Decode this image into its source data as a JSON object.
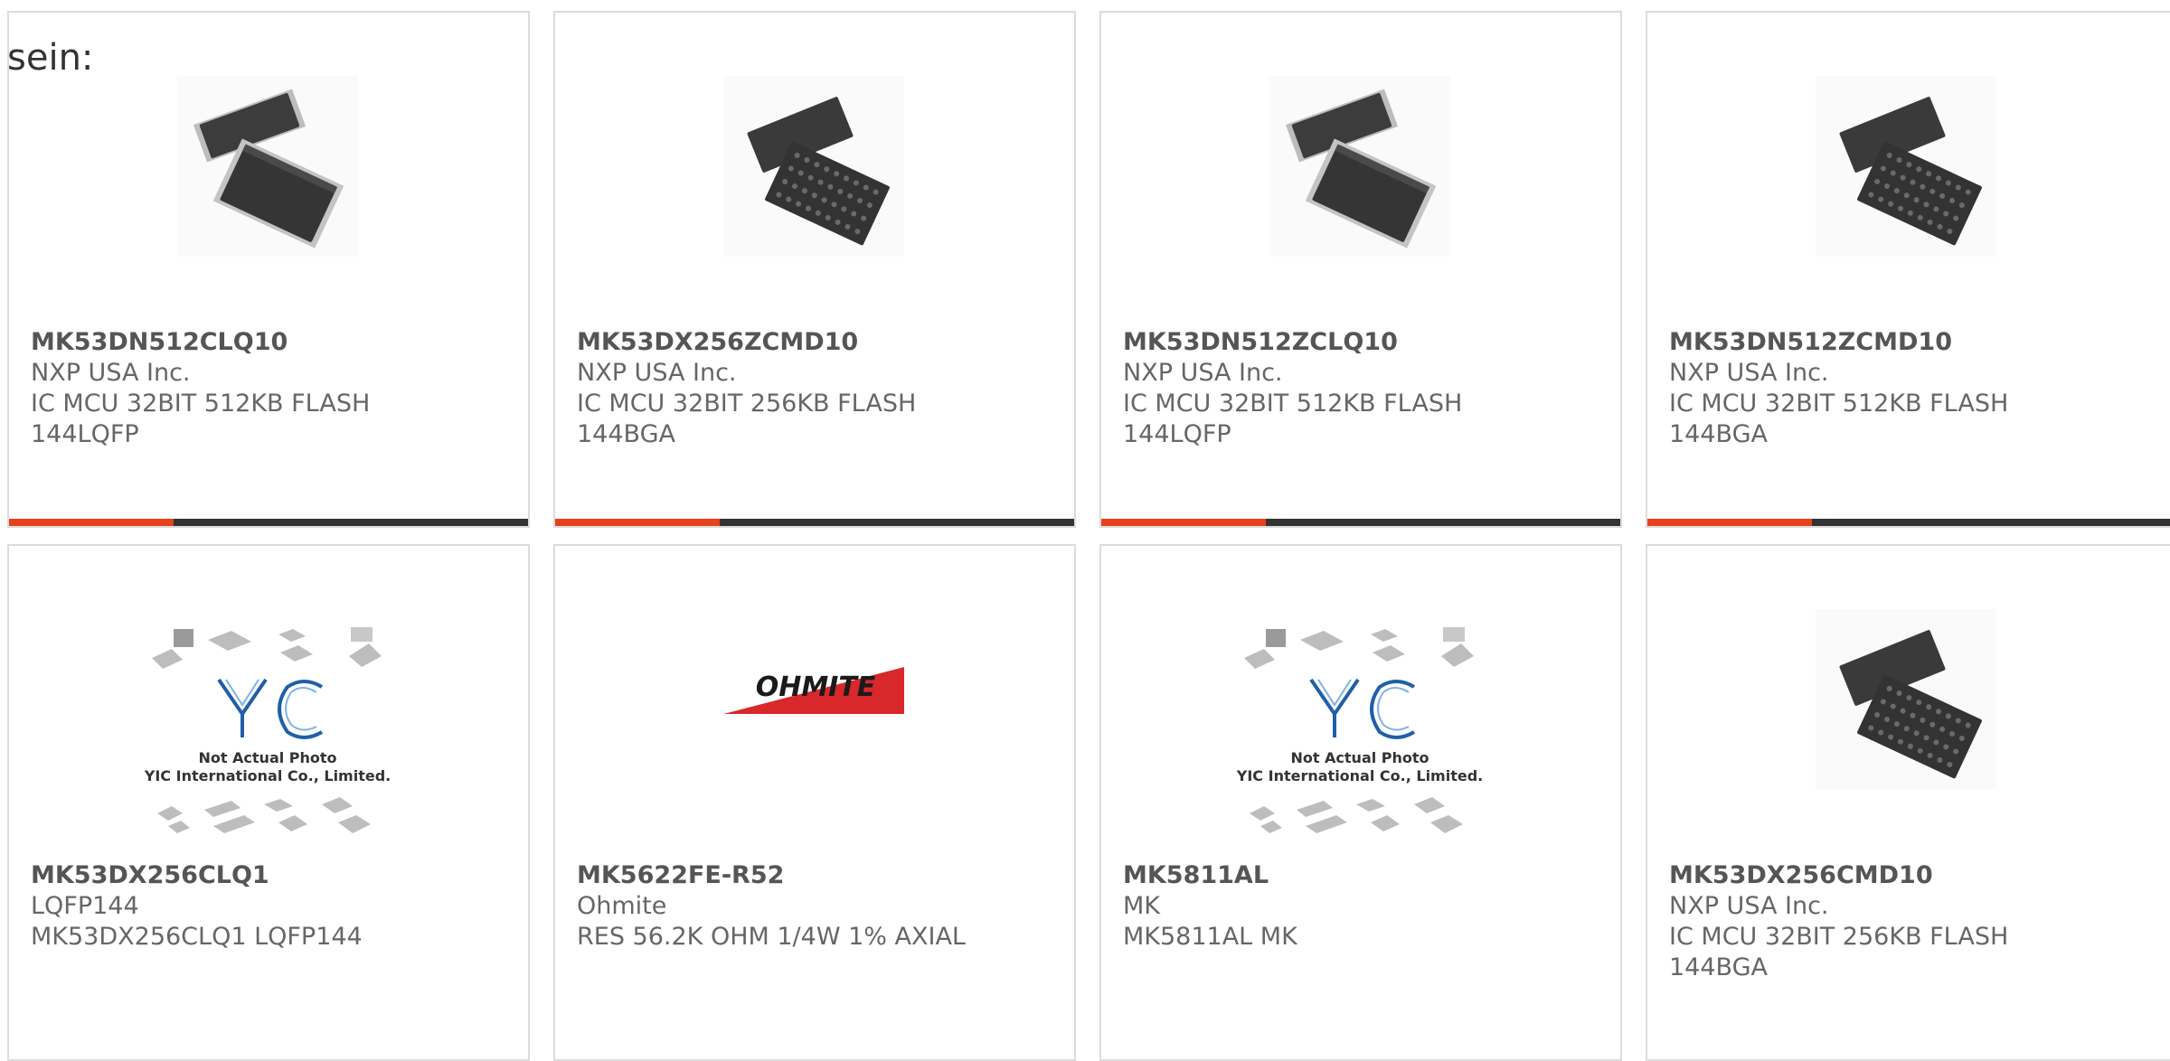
{
  "heading": "sein:",
  "accent_color": "#e8421c",
  "bar_color": "#333333",
  "products": [
    {
      "part": "MK53DN512CLQ10",
      "line1": "NXP USA Inc.",
      "line2": "IC MCU 32BIT 512KB FLASH",
      "line3": "144LQFP",
      "image": "qfp-chip-icon"
    },
    {
      "part": "MK53DX256ZCMD10",
      "line1": "NXP USA Inc.",
      "line2": "IC MCU 32BIT 256KB FLASH",
      "line3": "144BGA",
      "image": "bga-chip-icon"
    },
    {
      "part": "MK53DN512ZCLQ10",
      "line1": "NXP USA Inc.",
      "line2": "IC MCU 32BIT 512KB FLASH",
      "line3": "144LQFP",
      "image": "qfp-chip-icon"
    },
    {
      "part": "MK53DN512ZCMD10",
      "line1": "NXP USA Inc.",
      "line2": "IC MCU 32BIT 512KB FLASH",
      "line3": "144BGA",
      "image": "bga-chip-icon"
    },
    {
      "part": "MK53DX256CLQ1",
      "line1": "LQFP144",
      "line2": "MK53DX256CLQ1 LQFP144",
      "line3": "",
      "image": "yic-placeholder-image",
      "placeholder": {
        "logo": "YIC",
        "caption1": "Not Actual Photo",
        "caption2": "YIC International Co., Limited."
      }
    },
    {
      "part": "MK5622FE-R52",
      "line1": "Ohmite",
      "line2": "RES 56.2K OHM 1/4W 1% AXIAL",
      "line3": "",
      "image": "ohmite-logo",
      "logo_text": "OHMITE"
    },
    {
      "part": "MK5811AL",
      "line1": "MK",
      "line2": "MK5811AL MK",
      "line3": "",
      "image": "yic-placeholder-image",
      "placeholder": {
        "logo": "YIC",
        "caption1": "Not Actual Photo",
        "caption2": "YIC International Co., Limited."
      }
    },
    {
      "part": "MK53DX256CMD10",
      "line1": "NXP USA Inc.",
      "line2": "IC MCU 32BIT 256KB FLASH",
      "line3": "144BGA",
      "image": "bga-chip-icon"
    }
  ]
}
